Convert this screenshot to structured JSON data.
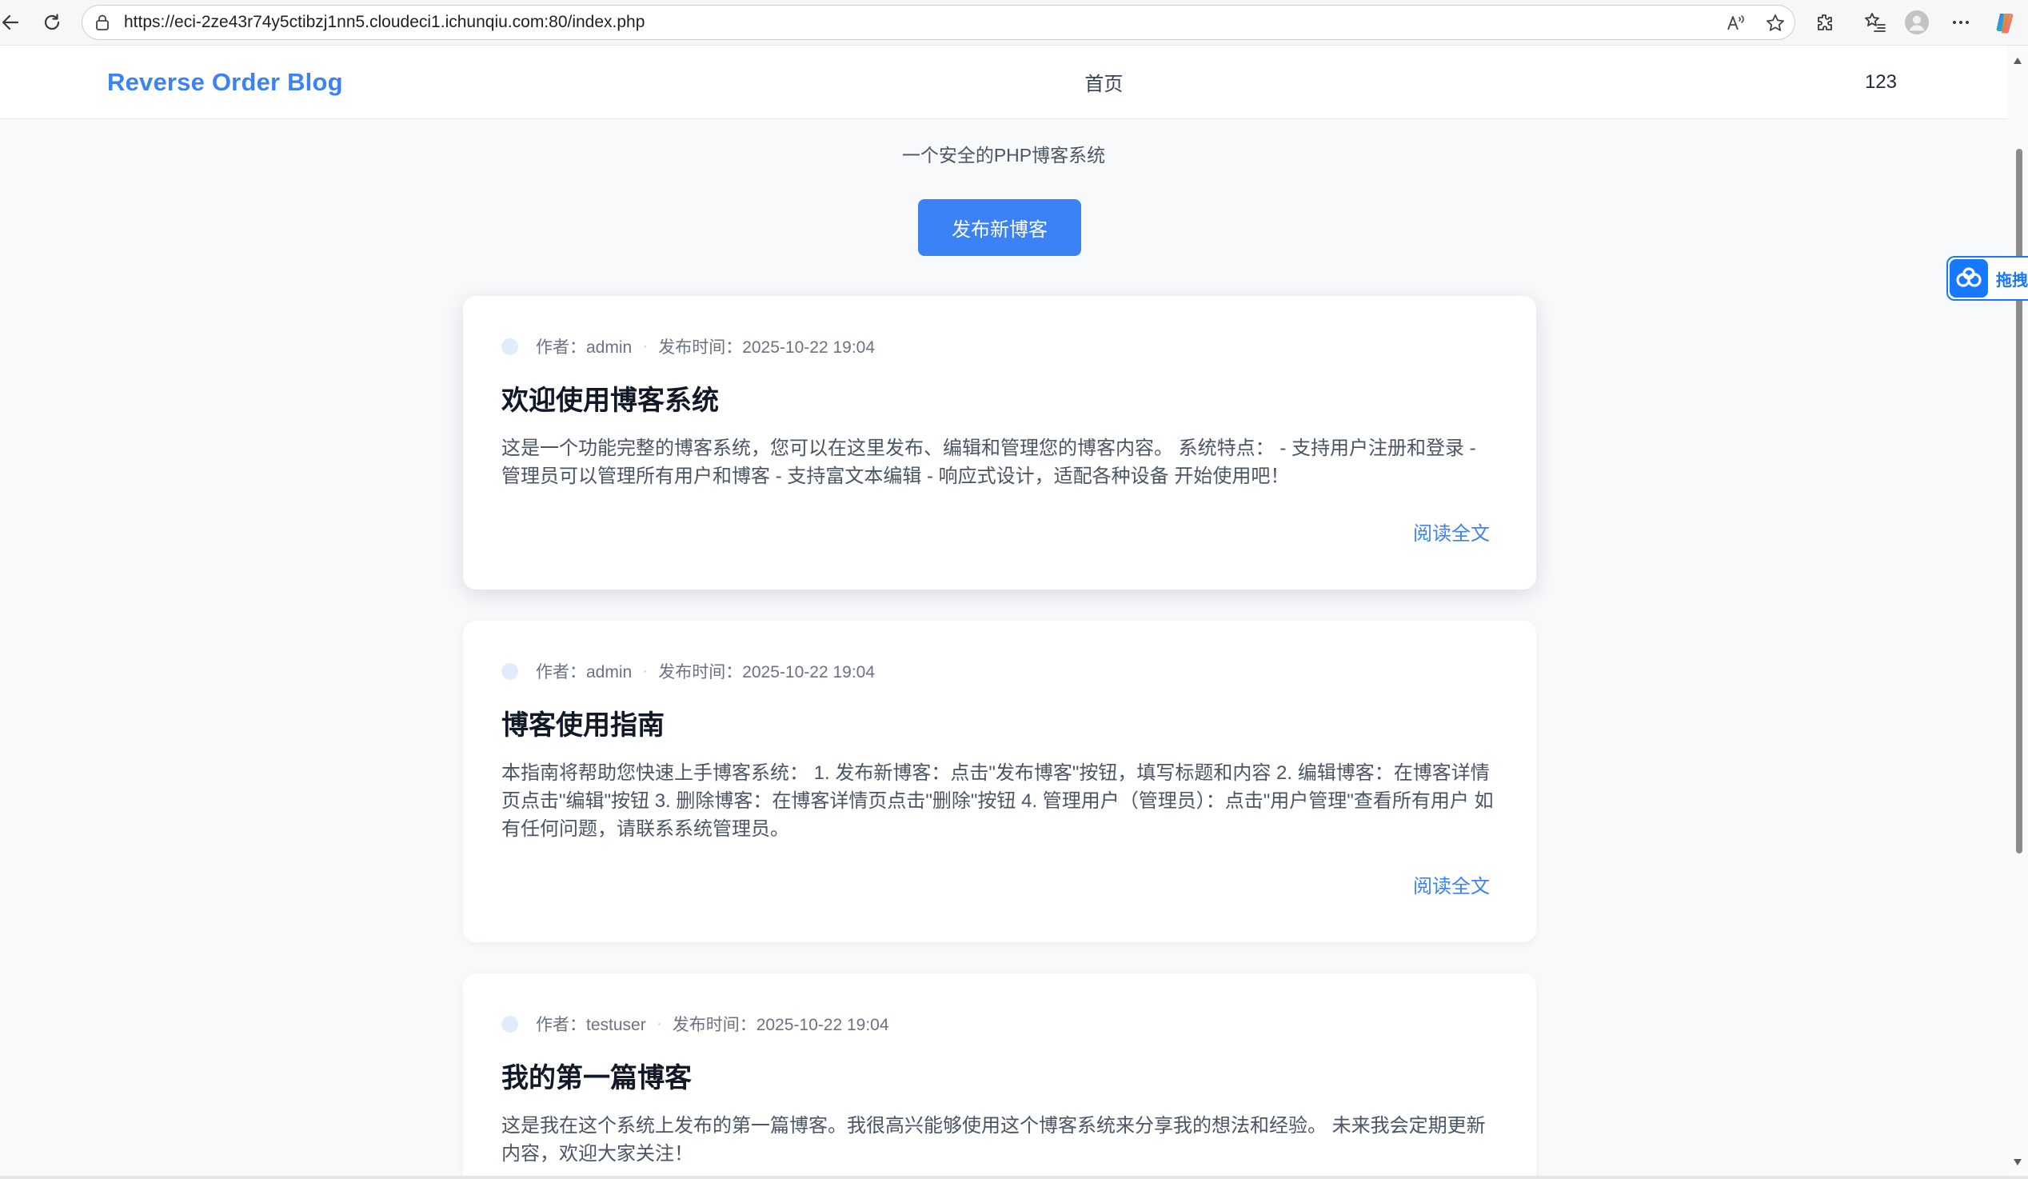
{
  "browser": {
    "url": "https://eci-2ze43r74y5ctibzj1nn5.cloudeci1.ichunqiu.com:80/index.php",
    "icons": [
      "back-icon",
      "reload-icon",
      "lock-icon",
      "read-aloud-icon",
      "favorite-star-icon",
      "extensions-icon",
      "favorites-icon",
      "profile-avatar",
      "more-icon",
      "copilot-icon"
    ]
  },
  "header": {
    "logo": "Reverse Order Blog",
    "nav_home": "首页",
    "user": "123"
  },
  "hero": {
    "subtitle": "一个安全的PHP博客系统",
    "publish_button": "发布新博客"
  },
  "meta_separator": "·",
  "posts": [
    {
      "author": "作者：admin",
      "published": "发布时间：2025-10-22 19:04",
      "title": "欢迎使用博客系统",
      "excerpt": "这是一个功能完整的博客系统，您可以在这里发布、编辑和管理您的博客内容。 系统特点： - 支持用户注册和登录 - 管理员可以管理所有用户和博客 - 支持富文本编辑 - 响应式设计，适配各种设备 开始使用吧！",
      "read_more": "阅读全文"
    },
    {
      "author": "作者：admin",
      "published": "发布时间：2025-10-22 19:04",
      "title": "博客使用指南",
      "excerpt": "本指南将帮助您快速上手博客系统： 1. 发布新博客：点击\"发布博客\"按钮，填写标题和内容 2. 编辑博客：在博客详情页点击\"编辑\"按钮 3. 删除博客：在博客详情页点击\"删除\"按钮 4. 管理用户（管理员）：点击\"用户管理\"查看所有用户 如有任何问题，请联系系统管理员。",
      "read_more": "阅读全文"
    },
    {
      "author": "作者：testuser",
      "published": "发布时间：2025-10-22 19:04",
      "title": "我的第一篇博客",
      "excerpt": "这是我在这个系统上发布的第一篇博客。我很高兴能够使用这个博客系统来分享我的想法和经验。 未来我会定期更新内容，欢迎大家关注！"
    }
  ],
  "side_widget": {
    "label": "拖拽",
    "icon": "cloud-icon"
  },
  "colors": {
    "accent": "#3b82f6",
    "page_bg": "#f8f9fb",
    "card_bg": "#ffffff",
    "title": "#111827",
    "body_text": "#4b5563",
    "meta_text": "#6b7280",
    "widget_blue": "#1677ff"
  }
}
